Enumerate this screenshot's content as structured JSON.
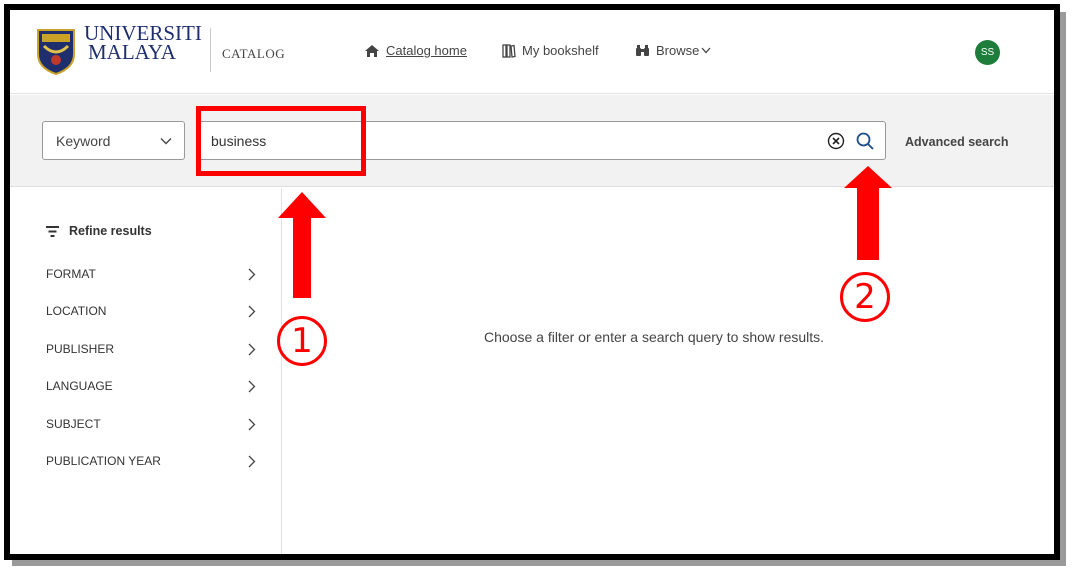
{
  "header": {
    "university_line1": "UNIVERSITI",
    "university_line2": "MALAYA",
    "catalog_label": "CATALOG",
    "nav": {
      "home": "Catalog home",
      "bookshelf": "My bookshelf",
      "browse": "Browse"
    },
    "avatar_initials": "SS"
  },
  "search": {
    "scope_selected": "Keyword",
    "query_value": "business",
    "advanced_label": "Advanced search"
  },
  "sidebar": {
    "refine_label": "Refine results",
    "facets": [
      {
        "label": "FORMAT"
      },
      {
        "label": "LOCATION"
      },
      {
        "label": "PUBLISHER"
      },
      {
        "label": "LANGUAGE"
      },
      {
        "label": "SUBJECT"
      },
      {
        "label": "PUBLICATION YEAR"
      }
    ]
  },
  "main": {
    "empty_message": "Choose a filter or enter a search query to show results."
  },
  "annotations": {
    "step1": "1",
    "step2": "2",
    "color": "#ff0000"
  },
  "colors": {
    "accent_navy": "#1f2f6e",
    "avatar_green": "#1e7d3b",
    "search_icon_blue": "#1f4e8c"
  }
}
